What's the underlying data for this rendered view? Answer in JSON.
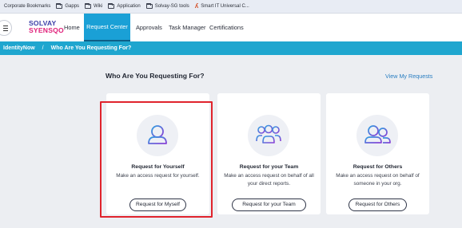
{
  "bookmarks": [
    {
      "label": "Corporate Bookmarks",
      "icon": "none"
    },
    {
      "label": "Gapps",
      "icon": "folder-icon"
    },
    {
      "label": "Wiki",
      "icon": "folder-icon"
    },
    {
      "label": "Application",
      "icon": "folder-icon"
    },
    {
      "label": "Solvay-SG tools",
      "icon": "folder-icon"
    },
    {
      "label": "Smart IT Universal C...",
      "icon": "glyph-icon"
    }
  ],
  "brand": {
    "line1": "SOLVAY",
    "line2": "SYENSQO"
  },
  "nav": {
    "home": "Home",
    "request_center": "Request Center",
    "approvals": "Approvals",
    "task_manager": "Task Manager",
    "certifications": "Certifications",
    "active": "Request Center",
    "active_color": "#1aa0d6"
  },
  "breadcrumb": {
    "root": "IdentityNow",
    "separator": "/",
    "current": "Who Are You Requesting For?"
  },
  "main": {
    "title": "Who Are You Requesting For?",
    "view_requests_link": "View My Requests"
  },
  "cards": [
    {
      "title": "Request for Yourself",
      "description": "Make an access request for yourself.",
      "button": "Request for Myself",
      "icon": "single-user-icon",
      "selected": true
    },
    {
      "title": "Request for your Team",
      "description": "Make an access request on behalf of all your direct reports.",
      "button": "Request for your Team",
      "icon": "team-icon",
      "selected": false
    },
    {
      "title": "Request for Others",
      "description": "Make an access request on behalf of someone in your org.",
      "button": "Request for Others",
      "icon": "two-users-icon",
      "selected": false
    }
  ],
  "colors": {
    "accent": "#1fa6cf",
    "icon_gradient_start": "#2f9fe0",
    "icon_gradient_end": "#8a3fd6",
    "highlight": "#e0232c"
  }
}
